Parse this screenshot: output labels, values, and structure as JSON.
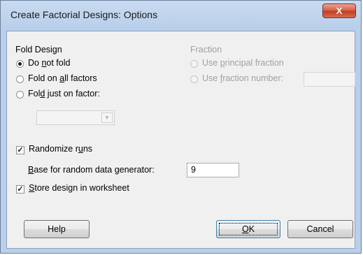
{
  "window": {
    "title": "Create Factorial Designs: Options",
    "close_label": "X"
  },
  "fold_design": {
    "heading": "Fold Design",
    "options": [
      {
        "pre": "Do ",
        "key": "n",
        "post": "ot fold",
        "checked": true
      },
      {
        "pre": "Fold on ",
        "key": "a",
        "post": "ll factors",
        "checked": false
      },
      {
        "pre": "Fol",
        "key": "d",
        "post": " just on factor:",
        "checked": false
      }
    ],
    "factor_select": ""
  },
  "fraction": {
    "heading": "Fraction",
    "options": [
      {
        "pre": "Use ",
        "key": "p",
        "post": "rincipal fraction",
        "checked": false
      },
      {
        "pre": "Use ",
        "key": "f",
        "post": "raction number:",
        "checked": false
      }
    ],
    "fraction_number": ""
  },
  "randomize": {
    "pre": "Randomize r",
    "key": "u",
    "post": "ns",
    "checked": true
  },
  "base": {
    "pre": "",
    "key": "B",
    "post": "ase for random data generator:",
    "value": "9"
  },
  "store": {
    "pre": "",
    "key": "S",
    "post": "tore design in worksheet",
    "checked": true
  },
  "buttons": {
    "help": "Help",
    "ok_key": "O",
    "ok_post": "K",
    "cancel": "Cancel"
  }
}
